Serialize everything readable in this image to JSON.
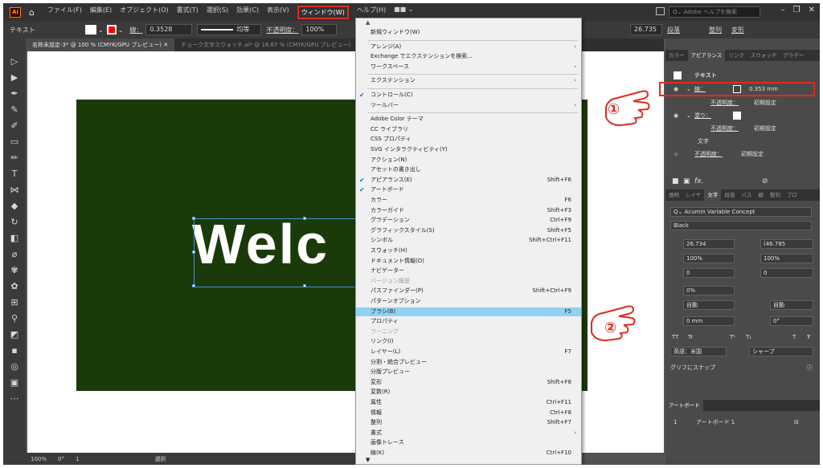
{
  "menubar": {
    "items": [
      "ファイル(F)",
      "編集(E)",
      "オブジェクト(O)",
      "書式(T)",
      "選択(S)",
      "効果(C)",
      "表示(V)",
      "ウィンドウ(W)",
      "ヘルプ(H)",
      "■■ ⌄"
    ],
    "search_placeholder": "Adobe ヘルプを検索",
    "logo": "Ai"
  },
  "control_bar": {
    "type_label": "テキスト",
    "stroke_label": "線：",
    "stroke_value": "0.3528",
    "stroke_style": "均等",
    "opacity_label": "不透明度：",
    "opacity_value": "100%",
    "right_value": "26.735",
    "right_labels": [
      "段落",
      "整列",
      "変形"
    ]
  },
  "doc_tabs": [
    "名称未設定-3* @ 100 % (CMYK/GPU プレビュー)",
    "チョーク文字スウォッチ.ai* @ 16.67 % (CMYK/GPU プレビュー)"
  ],
  "canvas": {
    "welcome_text": "Welc",
    "artboard_color": "#1a3a0a"
  },
  "status_bar": {
    "zoom": "100%",
    "rotation": "0°",
    "artboard_num": "1",
    "tool": "選択"
  },
  "window_menu": {
    "items": [
      {
        "label": "新規ウィンドウ(W)",
        "type": "item"
      },
      {
        "type": "sep"
      },
      {
        "label": "アレンジ(A)",
        "type": "item",
        "submenu": true
      },
      {
        "label": "Exchange でエクステンションを検索...",
        "type": "item"
      },
      {
        "label": "ワークスペース",
        "type": "item",
        "submenu": true
      },
      {
        "type": "sep"
      },
      {
        "label": "エクステンション",
        "type": "item",
        "submenu": true
      },
      {
        "type": "sep"
      },
      {
        "label": "コントロール(C)",
        "type": "item",
        "checked": true
      },
      {
        "label": "ツールバー",
        "type": "item",
        "submenu": true
      },
      {
        "type": "sep"
      },
      {
        "label": "Adobe Color テーマ",
        "type": "item"
      },
      {
        "label": "CC ライブラリ",
        "type": "item"
      },
      {
        "label": "CSS プロパティ",
        "type": "item"
      },
      {
        "label": "SVG インタラクティビティ(Y)",
        "type": "item"
      },
      {
        "label": "アクション(N)",
        "type": "item"
      },
      {
        "label": "アセットの書き出し",
        "type": "item"
      },
      {
        "label": "アピアランス(E)",
        "type": "item",
        "checked": true,
        "shortcut": "Shift+F6"
      },
      {
        "label": "アートボード",
        "type": "item",
        "checked": true
      },
      {
        "label": "カラー",
        "type": "item",
        "shortcut": "F6"
      },
      {
        "label": "カラーガイド",
        "type": "item",
        "shortcut": "Shift+F3"
      },
      {
        "label": "グラデーション",
        "type": "item",
        "shortcut": "Ctrl+F9"
      },
      {
        "label": "グラフィックスタイル(S)",
        "type": "item",
        "shortcut": "Shift+F5"
      },
      {
        "label": "シンボル",
        "type": "item",
        "shortcut": "Shift+Ctrl+F11"
      },
      {
        "label": "スウォッチ(H)",
        "type": "item"
      },
      {
        "label": "ドキュメント情報(D)",
        "type": "item"
      },
      {
        "label": "ナビゲーター",
        "type": "item"
      },
      {
        "label": "バージョン履歴",
        "type": "item",
        "disabled": true
      },
      {
        "label": "パスファインダー(P)",
        "type": "item",
        "shortcut": "Shift+Ctrl+F9"
      },
      {
        "label": "パターンオプション",
        "type": "item"
      },
      {
        "label": "ブラシ(B)",
        "type": "item",
        "shortcut": "F5",
        "highlight": true
      },
      {
        "label": "プロパティ",
        "type": "item"
      },
      {
        "label": "ラーニング",
        "type": "item",
        "disabled": true
      },
      {
        "label": "リンク(I)",
        "type": "item"
      },
      {
        "label": "レイヤー(L)",
        "type": "item",
        "shortcut": "F7"
      },
      {
        "label": "分割・統合プレビュー",
        "type": "item"
      },
      {
        "label": "分版プレビュー",
        "type": "item"
      },
      {
        "label": "変形",
        "type": "item",
        "shortcut": "Shift+F8"
      },
      {
        "label": "変数(R)",
        "type": "item"
      },
      {
        "label": "属性",
        "type": "item",
        "shortcut": "Ctrl+F11"
      },
      {
        "label": "情報",
        "type": "item",
        "shortcut": "Ctrl+F8"
      },
      {
        "label": "整列",
        "type": "item",
        "shortcut": "Shift+F7"
      },
      {
        "label": "書式",
        "type": "item",
        "submenu": true
      },
      {
        "label": "画像トレース",
        "type": "item"
      },
      {
        "label": "線(K)",
        "type": "item",
        "shortcut": "Ctrl+F10"
      }
    ]
  },
  "appearance_panel": {
    "tabs": [
      "カラー",
      "アピアランス",
      "リンク",
      "スウォッチ",
      "グラデー"
    ],
    "title": "テキスト",
    "stroke_label": "線：",
    "stroke_value": "0.353 mm",
    "opacity_label": "不透明度：",
    "opacity_value": "初期設定",
    "fill_label": "塗り：",
    "char_label": "文字"
  },
  "char_panel": {
    "tabs": [
      "透明",
      "レイヤ",
      "文字",
      "段落",
      "パス",
      "線",
      "整列",
      "プロ"
    ],
    "font_name": "Acumin Variable Concept",
    "font_style": "Black",
    "size": "26.734",
    "leading": "(46.785",
    "vscale": "100%",
    "hscale": "100%",
    "kerning": "0",
    "tracking": "0",
    "rotate_pct": "0%",
    "auto1": "自動",
    "auto2": "自動",
    "baseline": "0 mm",
    "angle": "0°",
    "language": "英語：米国",
    "aa": "シャープ",
    "snap": "グリフにスナップ"
  },
  "artboard_panel": {
    "tab": "アートボード",
    "row_num": "1",
    "row_name": "アートボード 1"
  },
  "callouts": {
    "one": "①",
    "two": "②"
  },
  "accent": {
    "red": "#e02a20",
    "highlight": "#91d2f1"
  }
}
